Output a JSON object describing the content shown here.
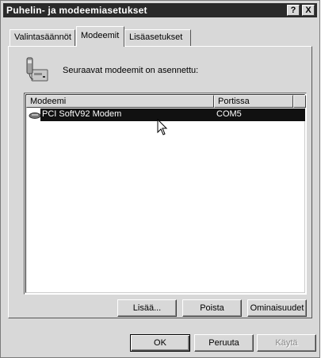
{
  "window": {
    "title": "Puhelin- ja modeemiasetukset",
    "help_glyph": "?",
    "close_glyph": "X"
  },
  "tabs": [
    {
      "label": "Valintasäännöt",
      "active": false
    },
    {
      "label": "Modeemit",
      "active": true
    },
    {
      "label": "Lisäasetukset",
      "active": false
    }
  ],
  "panel": {
    "installed_text": "Seuraavat modeemit on asennettu:"
  },
  "modem_list": {
    "columns": [
      "Modeemi",
      "Portissa"
    ],
    "rows": [
      {
        "modem": "PCI SoftV92 Modem",
        "port": "COM5",
        "selected": true
      }
    ]
  },
  "panel_buttons": {
    "add": "Lisää...",
    "remove": "Poista",
    "properties": "Ominaisuudet"
  },
  "dialog_buttons": {
    "ok": "OK",
    "cancel": "Peruuta",
    "apply": "Käytä"
  },
  "icons": {
    "phone": "phone-modem-icon",
    "modem": "modem-icon",
    "cursor": "mouse-pointer-icon"
  }
}
